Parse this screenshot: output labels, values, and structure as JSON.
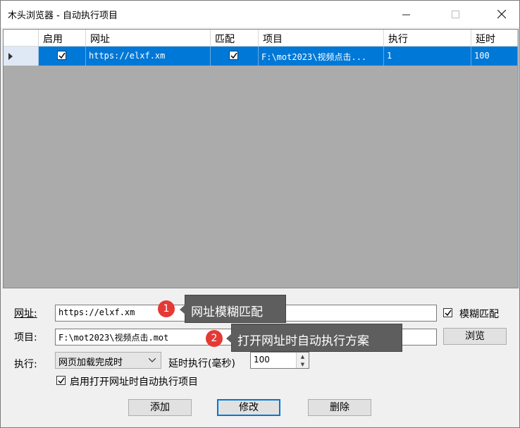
{
  "window": {
    "title": "木头浏览器 - 自动执行项目"
  },
  "grid": {
    "headers": [
      "启用",
      "网址",
      "匹配",
      "项目",
      "执行",
      "延时"
    ],
    "rows": [
      {
        "enabled": true,
        "url": "https://elxf.xm",
        "match": true,
        "project": "F:\\mot2023\\视频点击...",
        "exec": "1",
        "delay": "100"
      }
    ]
  },
  "form": {
    "url_label": "网址:",
    "url_value": "https://elxf.xm",
    "fuzzy_label": "模糊匹配",
    "fuzzy_checked": true,
    "project_label": "项目:",
    "project_value": "F:\\mot2023\\视频点击.mot",
    "browse_label": "浏览",
    "exec_label": "执行:",
    "exec_selected": "网页加载完成时",
    "delay_label": "延时执行(毫秒)",
    "delay_value": "100",
    "auto_label": "启用打开网址时自动执行项目",
    "auto_checked": true
  },
  "buttons": {
    "add": "添加",
    "modify": "修改",
    "delete": "删除"
  },
  "callouts": [
    {
      "badge": "1",
      "text": "网址模糊匹配"
    },
    {
      "badge": "2",
      "text": "打开网址时自动执行方案"
    }
  ],
  "colors": {
    "selection": "#0078d7",
    "grid_bg": "#ababab",
    "badge": "#e53935",
    "callout": "#5e5e5e"
  }
}
